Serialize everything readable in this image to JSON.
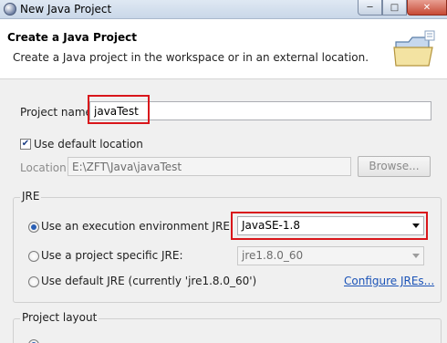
{
  "window": {
    "title": "New Java Project"
  },
  "header": {
    "title": "Create a Java Project",
    "description": "Create a Java project in the workspace or in an external location."
  },
  "project": {
    "name_label": "Project name:",
    "name_value": "javaTest",
    "use_default_location_label": "Use default location",
    "use_default_location_checked": true,
    "location_label": "Location:",
    "location_value": "E:\\ZFT\\Java\\javaTest",
    "browse_label": "Browse..."
  },
  "jre": {
    "group_title": "JRE",
    "option_execution_env": "Use an execution environment JRE:",
    "execution_env_value": "JavaSE-1.8",
    "option_project_specific": "Use a project specific JRE:",
    "project_specific_value": "jre1.8.0_60",
    "option_default": "Use default JRE (currently 'jre1.8.0_60')",
    "configure_link": "Configure JREs...",
    "selected": "execution_env"
  },
  "layout": {
    "group_title": "Project layout"
  },
  "colors": {
    "highlight": "#d9161b",
    "link": "#1b53b7"
  }
}
